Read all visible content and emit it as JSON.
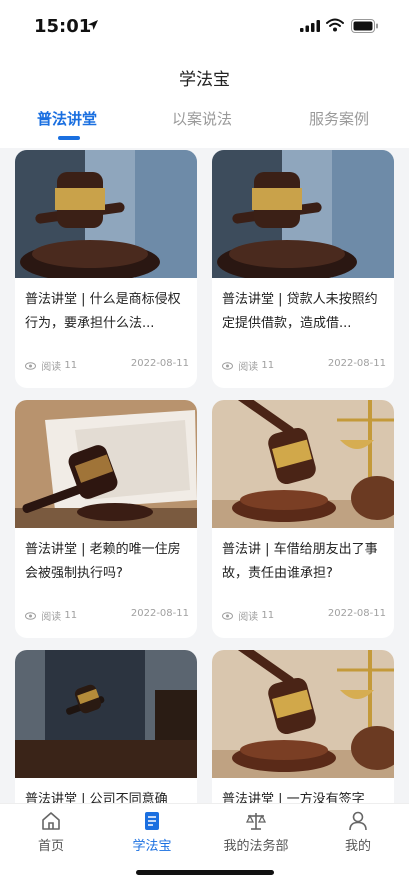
{
  "status": {
    "time": "15:01"
  },
  "header": {
    "title": "学法宝"
  },
  "tabs": [
    {
      "label": "普法讲堂",
      "active": true
    },
    {
      "label": "以案说法",
      "active": false
    },
    {
      "label": "服务案例",
      "active": false
    }
  ],
  "cards": [
    {
      "title": "普法讲堂 | 什么是商标侵权行为，要承担什么法...",
      "reads_label": "阅读",
      "reads": "11",
      "date": "2022-08-11",
      "image": "gavel-suit-icon"
    },
    {
      "title": "普法讲堂 | 贷款人未按照约定提供借款，造成借...",
      "reads_label": "阅读",
      "reads": "11",
      "date": "2022-08-11",
      "image": "gavel-suit-icon"
    },
    {
      "title": "普法讲堂 | 老赖的唯一住房会被强制执行吗?",
      "reads_label": "阅读",
      "reads": "11",
      "date": "2022-08-11",
      "image": "gavel-book-icon"
    },
    {
      "title": "普法讲  | 车借给朋友出了事故，责任由谁承担?",
      "reads_label": "阅读",
      "reads": "11",
      "date": "2022-08-11",
      "image": "gavel-scale-icon"
    },
    {
      "title": "普法讲堂 | 公司不同意确",
      "reads_label": "",
      "reads": "",
      "date": "",
      "image": "gavel-judge-icon"
    },
    {
      "title": "普法讲堂 | 一方没有签字",
      "reads_label": "",
      "reads": "",
      "date": "",
      "image": "gavel-scale-icon"
    }
  ],
  "nav": [
    {
      "label": "首页",
      "icon": "home-icon",
      "active": false
    },
    {
      "label": "学法宝",
      "icon": "document-icon",
      "active": true
    },
    {
      "label": "我的法务部",
      "icon": "scales-icon",
      "active": false
    },
    {
      "label": "我的",
      "icon": "user-icon",
      "active": false
    }
  ],
  "colors": {
    "accent": "#1a6fe0",
    "background": "#f3f4f6"
  }
}
